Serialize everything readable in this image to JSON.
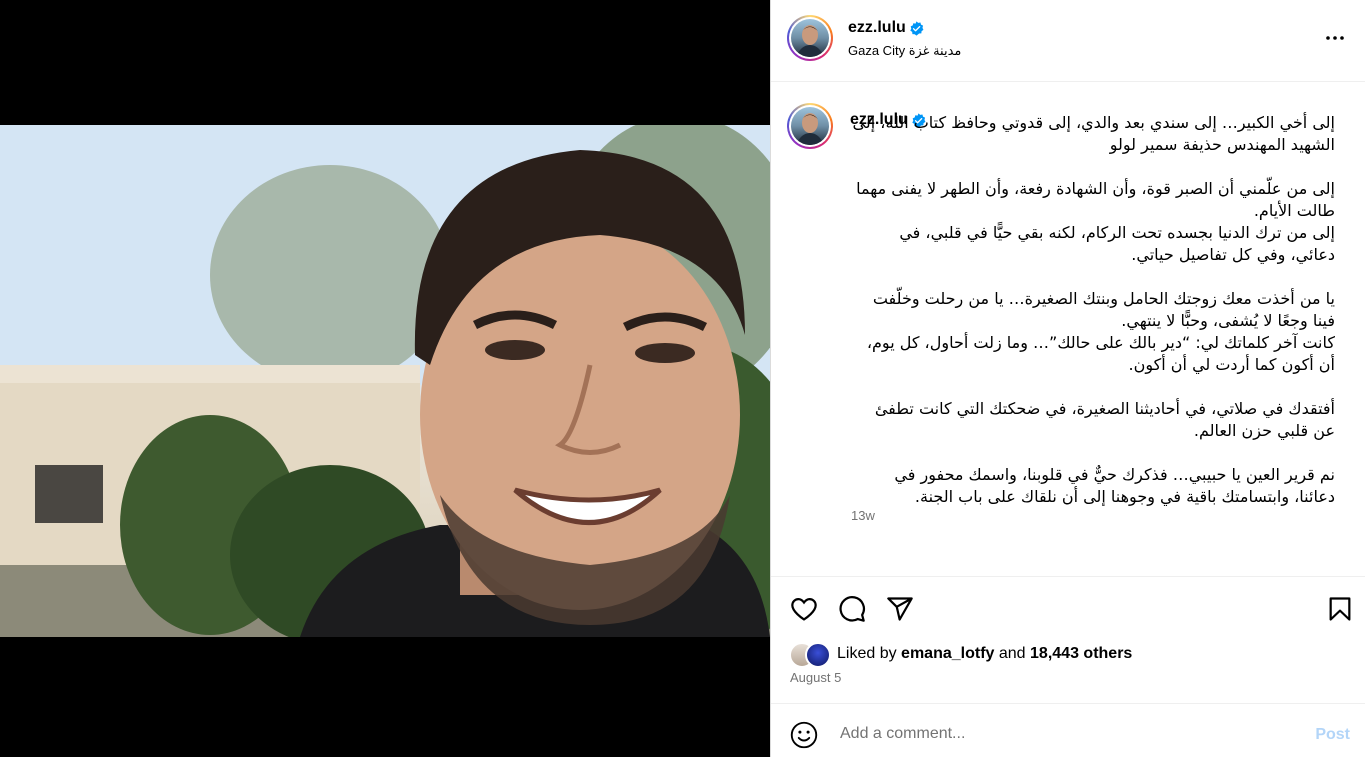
{
  "post": {
    "username": "ezz.lulu",
    "location": "Gaza City مدينة غزة",
    "caption": "إلى أخي الكبير… إلى سندي بعد والدي، إلى قدوتي وحافظ كتاب الله، إلى الشهيد المهندس حذيفة سمير لولو\n\nإلى من علّمني أن الصبر قوة، وأن الشهادة رفعة، وأن الطهر لا يفنى مهما طالت الأيام.\nإلى من ترك الدنيا بجسده تحت الركام، لكنه بقي حيًّا في قلبي، في دعائي، وفي كل تفاصيل حياتي.\n\nيا من أخذت معك زوجتك الحامل وبنتك الصغيرة… يا من رحلت وخلّفت فينا وجعًا لا يُشفى، وحبًّا لا ينتهي.\nكانت آخر كلماتك لي: “دير بالك على حالك”… وما زلت أحاول، كل يوم، أن أكون كما أردت لي أن أكون.\n\nأفتقدك في صلاتي، في أحاديثنا الصغيرة، في ضحكتك التي كانت تطفئ عن قلبي حزن العالم.\n\nنم قرير العين يا حبيبي… فذكرك حيٌّ في قلوبنا، واسمك محفور في دعائنا، وابتسامتك باقية في وجوهنا إلى أن نلقاك على باب الجنة.",
    "time_ago": "13w",
    "likes": {
      "prefix": "Liked by",
      "user": "emana_lotfy",
      "joiner": "and",
      "others": "18,443 others"
    },
    "date": "August 5"
  },
  "comment": {
    "placeholder": "Add a comment...",
    "post_label": "Post"
  },
  "icons": {
    "more": "more-horizontal-icon",
    "like": "heart-icon",
    "comment": "comment-icon",
    "share": "send-icon",
    "save": "bookmark-icon",
    "emoji": "emoji-icon",
    "verified": "verified-badge-icon"
  },
  "colors": {
    "verified": "#0095f6",
    "muted": "#737373",
    "post_disabled": "#b3d5f8"
  }
}
